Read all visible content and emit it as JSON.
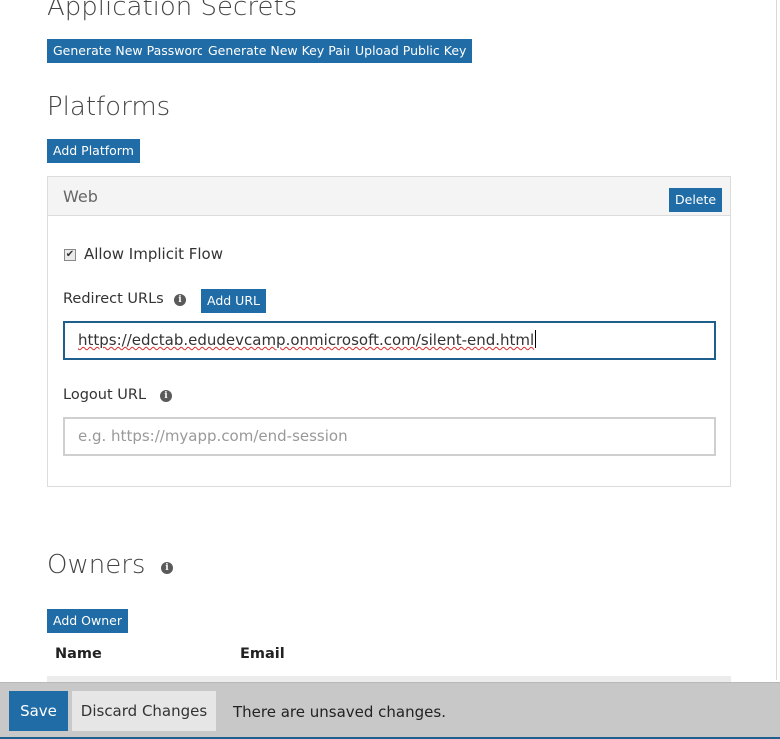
{
  "secrets": {
    "title": "Application Secrets",
    "buttons": {
      "generate_password": "Generate New Password",
      "generate_key_pair": "Generate New Key Pair",
      "upload_public_key": "Upload Public Key"
    }
  },
  "platforms": {
    "title": "Platforms",
    "add_button": "Add Platform",
    "web": {
      "title": "Web",
      "delete_button": "Delete",
      "implicit_flow_label": "Allow Implicit Flow",
      "implicit_flow_checked": true,
      "redirect_label": "Redirect URLs",
      "add_url_button": "Add URL",
      "redirect_value": "https://edctab.edudevcamp.onmicrosoft.com/silent-end.html",
      "logout_label": "Logout URL",
      "logout_placeholder": "e.g. https://myapp.com/end-session",
      "logout_value": ""
    }
  },
  "owners": {
    "title": "Owners",
    "add_button": "Add Owner",
    "columns": [
      "Name",
      "Email"
    ]
  },
  "footer": {
    "save": "Save",
    "discard": "Discard Changes",
    "status": "There are unsaved changes."
  },
  "icons": {
    "info": "info-icon",
    "checkbox": "checkmark-icon"
  },
  "colors": {
    "accent": "#1f6ca6",
    "footer_bg": "#c8c8c8"
  }
}
